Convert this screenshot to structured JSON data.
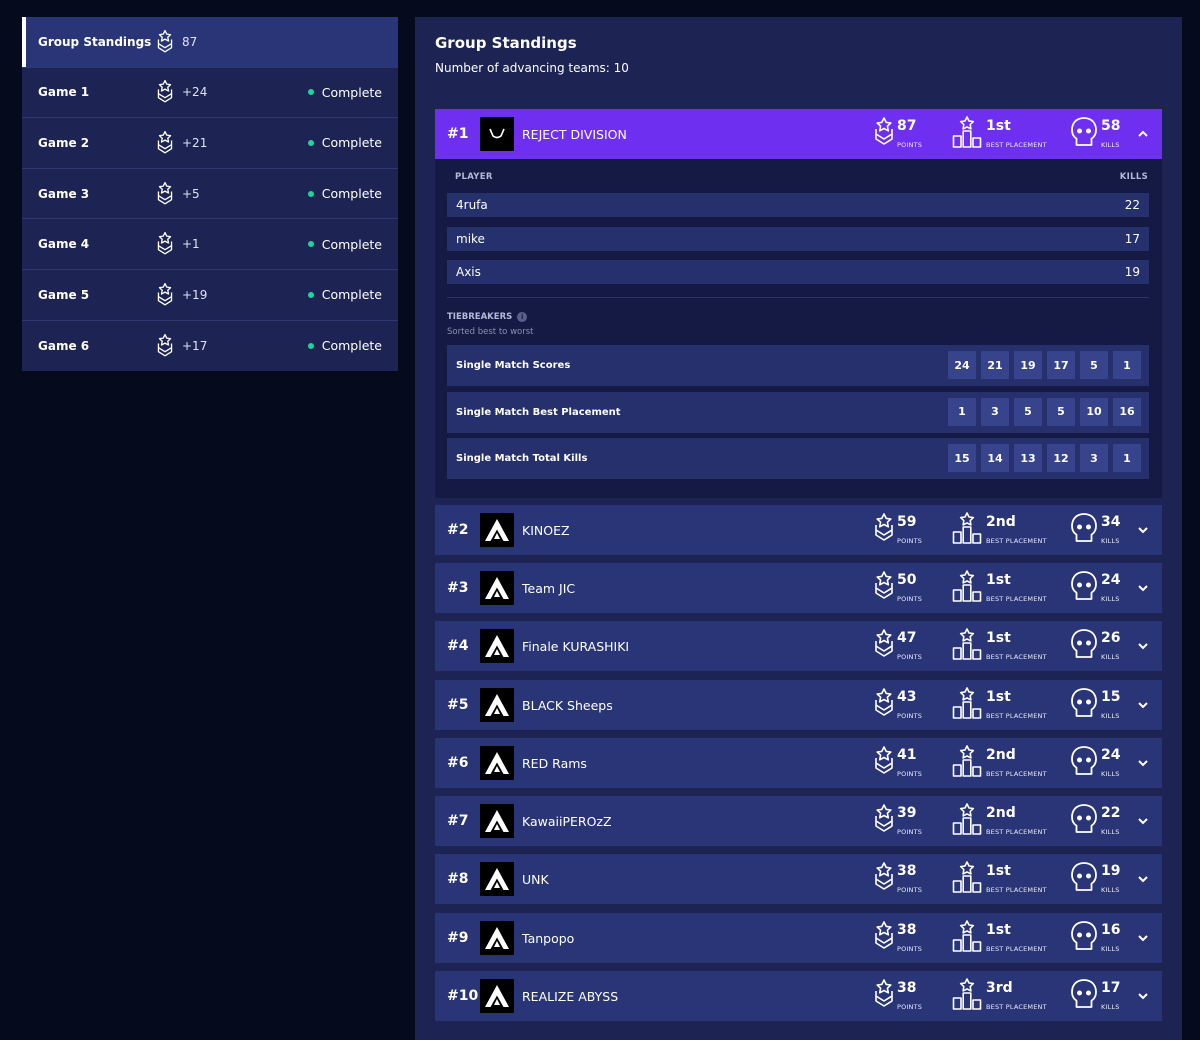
{
  "sidebar": {
    "items": [
      {
        "label": "Group Standings",
        "points": "87",
        "status": "",
        "active": true
      },
      {
        "label": "Game 1",
        "points": "+24",
        "status": "Complete"
      },
      {
        "label": "Game 2",
        "points": "+21",
        "status": "Complete"
      },
      {
        "label": "Game 3",
        "points": "+5",
        "status": "Complete"
      },
      {
        "label": "Game 4",
        "points": "+1",
        "status": "Complete"
      },
      {
        "label": "Game 5",
        "points": "+19",
        "status": "Complete"
      },
      {
        "label": "Game 6",
        "points": "+17",
        "status": "Complete"
      }
    ]
  },
  "main": {
    "title": "Group Standings",
    "subtitle": "Number of advancing teams: 10",
    "labels": {
      "points": "POINTS",
      "best_placement": "BEST PLACEMENT",
      "kills": "KILLS"
    },
    "teams": [
      {
        "rank": "#1",
        "name": "REJECT DIVISION",
        "points": "87",
        "best": "1st",
        "kills": "58",
        "expanded": true
      },
      {
        "rank": "#2",
        "name": "KINOEZ",
        "points": "59",
        "best": "2nd",
        "kills": "34"
      },
      {
        "rank": "#3",
        "name": "Team JIC",
        "points": "50",
        "best": "1st",
        "kills": "24"
      },
      {
        "rank": "#4",
        "name": "Finale KURASHIKI",
        "points": "47",
        "best": "1st",
        "kills": "26"
      },
      {
        "rank": "#5",
        "name": "BLACK Sheeps",
        "points": "43",
        "best": "1st",
        "kills": "15"
      },
      {
        "rank": "#6",
        "name": "RED Rams",
        "points": "41",
        "best": "2nd",
        "kills": "24"
      },
      {
        "rank": "#7",
        "name": "KawaiiPEROzZ",
        "points": "39",
        "best": "2nd",
        "kills": "22"
      },
      {
        "rank": "#8",
        "name": "UNK",
        "points": "38",
        "best": "1st",
        "kills": "19"
      },
      {
        "rank": "#9",
        "name": "Tanpopo",
        "points": "38",
        "best": "1st",
        "kills": "16"
      },
      {
        "rank": "#10",
        "name": "REALIZE ABYSS",
        "points": "38",
        "best": "3rd",
        "kills": "17"
      }
    ],
    "details": {
      "player_header": "PLAYER",
      "kills_header": "KILLS",
      "players": [
        {
          "name": "4rufa",
          "kills": "22"
        },
        {
          "name": "mike",
          "kills": "17"
        },
        {
          "name": "Axis",
          "kills": "19"
        }
      ],
      "tiebreakers_title": "TIEBREAKERS",
      "tiebreakers_info": "i",
      "tiebreakers_sub": "Sorted best to worst",
      "tiebreakers": [
        {
          "label": "Single Match Scores",
          "values": [
            "24",
            "21",
            "19",
            "17",
            "5",
            "1"
          ]
        },
        {
          "label": "Single Match Best Placement",
          "values": [
            "1",
            "3",
            "5",
            "5",
            "10",
            "16"
          ]
        },
        {
          "label": "Single Match Total Kills",
          "values": [
            "15",
            "14",
            "13",
            "12",
            "3",
            "1"
          ]
        }
      ]
    }
  }
}
